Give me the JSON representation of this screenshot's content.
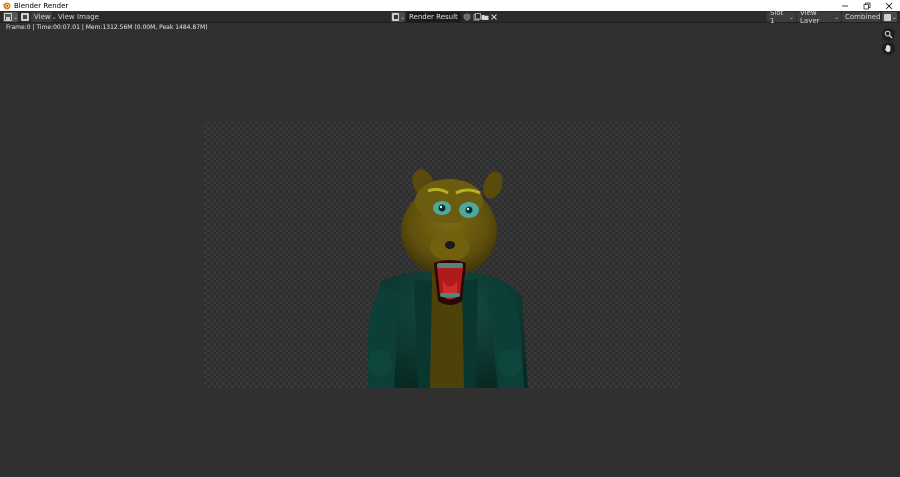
{
  "window": {
    "title": "Blender Render",
    "app_icon": "blender-logo-icon",
    "controls": [
      "minimize-icon",
      "restore-icon",
      "close-icon"
    ]
  },
  "header": {
    "editor_type_icon": "image-editor-icon",
    "view_mode_icon": "view-mode-icon",
    "menus": {
      "view_dropdown": "View",
      "view": "View",
      "image": "Image"
    },
    "image": {
      "browse_icon": "image-browse-icon",
      "name": "Render Result",
      "icons": [
        "fake-user-shield-icon",
        "new-image-icon",
        "open-folder-icon",
        "unlink-x-icon"
      ]
    },
    "slot": "Slot 1",
    "view_layer": "View Layer",
    "pass": "Combined",
    "display_icon": "display-channels-icon"
  },
  "viewport": {
    "status": "Frame:0 | Time:00:07.01 | Mem:1312.56M (0.00M, Peak 1484.87M)",
    "nav_icons": [
      "zoom-icon",
      "hand-pan-icon"
    ]
  },
  "colors": {
    "titlebar_bg": "#ffffff",
    "header_bg": "#2b2b2b",
    "viewport_bg": "#303030",
    "checker_dark": "#2e2e2e",
    "checker_light": "#383838",
    "character_fur": "#6b5a10",
    "character_jacket": "#0f3b34"
  }
}
